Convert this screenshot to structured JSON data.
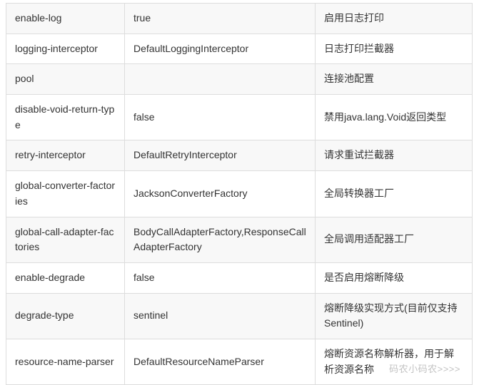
{
  "table": {
    "rows": [
      {
        "key": "enable-log",
        "value": "true",
        "desc": "启用日志打印"
      },
      {
        "key": "logging-interceptor",
        "value": "DefaultLoggingInterceptor",
        "desc": "日志打印拦截器"
      },
      {
        "key": "pool",
        "value": "",
        "desc": "连接池配置"
      },
      {
        "key": "disable-void-return-type",
        "value": "false",
        "desc": "禁用java.lang.Void返回类型"
      },
      {
        "key": "retry-interceptor",
        "value": "DefaultRetryInterceptor",
        "desc": "请求重试拦截器"
      },
      {
        "key": "global-converter-factories",
        "value": "JacksonConverterFactory",
        "desc": "全局转换器工厂"
      },
      {
        "key": "global-call-adapter-factories",
        "value": "BodyCallAdapterFactory,ResponseCallAdapterFactory",
        "desc": "全局调用适配器工厂"
      },
      {
        "key": "enable-degrade",
        "value": "false",
        "desc": "是否启用熔断降级"
      },
      {
        "key": "degrade-type",
        "value": "sentinel",
        "desc": "熔断降级实现方式(目前仅支持Sentinel)"
      },
      {
        "key": "resource-name-parser",
        "value": "DefaultResourceNameParser",
        "desc": "熔断资源名称解析器，用于解析资源名称"
      }
    ]
  },
  "watermark": "码农小码农>>>>"
}
